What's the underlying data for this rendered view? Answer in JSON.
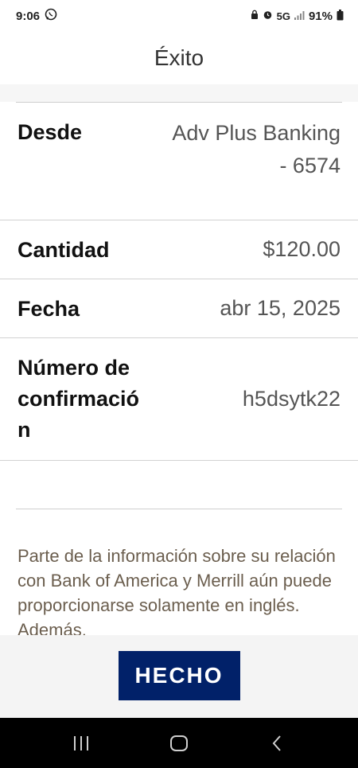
{
  "status_bar": {
    "time": "9:06",
    "network": "5G",
    "battery": "91%",
    "icons": [
      "whatsapp-icon",
      "lock-icon",
      "alarm-icon",
      "signal-icon",
      "battery-icon"
    ]
  },
  "header": {
    "title": "Éxito"
  },
  "details": {
    "from_label": "Desde",
    "from_value": "Adv Plus Banking - 6574",
    "amount_label": "Cantidad",
    "amount_value": "$120.00",
    "date_label": "Fecha",
    "date_value": "abr 15, 2025",
    "confirmation_label": "Número de confirmación",
    "confirmation_value": "h5dsytk22"
  },
  "disclaimer": "Parte de la información sobre su relación con Bank of America y Merrill aún puede proporcionarse solamente en inglés. Además,",
  "actions": {
    "done_label": "HECHO"
  },
  "nav_bar": {
    "icons": [
      "recent-apps-icon",
      "home-icon",
      "back-icon"
    ]
  },
  "colors": {
    "brand_navy": "#012169",
    "disclaimer_text": "#6b5e4e",
    "divider": "#d2d2d2"
  }
}
